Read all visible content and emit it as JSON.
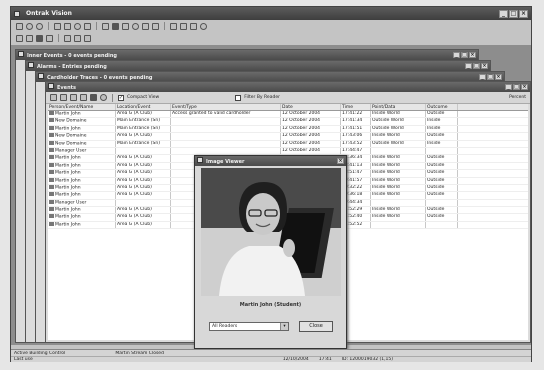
{
  "app": {
    "title": "Ontrak Vision"
  },
  "windows": [
    {
      "title": "Inner Events - 0 events pending"
    },
    {
      "title": "Alarms - Entries pending"
    },
    {
      "title": "Cardholder Traces - 0 events pending"
    }
  ],
  "events_window": {
    "title": "Events",
    "toolbar": {
      "compact_view_label": "Compact View",
      "filter_label": "Filter By Reader"
    },
    "columns": [
      "Person/Event/Name",
      "Location/Event",
      "Event/Type",
      "Date",
      "Time",
      "Point/Data",
      "Outcome"
    ],
    "extra_column": "Percent",
    "rows": [
      [
        "Martin John",
        "Area G (A Club)",
        "Access granted to valid cardholder",
        "12 October 2004",
        "17:41:22",
        "Inside World",
        "Outside"
      ],
      [
        "New Domaine",
        "Main Entrance (Sn)",
        "",
        "12 October 2004",
        "17:41:34",
        "Outside World",
        "Inside"
      ],
      [
        "Martin John",
        "Main Entrance (Sn)",
        "",
        "12 October 2004",
        "17:41:51",
        "Outside World",
        "Inside"
      ],
      [
        "New Domaine",
        "Area G (A Club)",
        "",
        "12 October 2004",
        "17:43:06",
        "Inside World",
        "Outside"
      ],
      [
        "New Domaine",
        "Main Entrance (Sn)",
        "",
        "12 October 2004",
        "17:43:52",
        "Outside World",
        "Inside"
      ],
      [
        "Manager User",
        "",
        "",
        "12 October 2004",
        "17:44:47",
        "",
        ""
      ],
      [
        "Martin John",
        "Area G (A Club)",
        "",
        "12 October 2004",
        "18:36:34",
        "Inside World",
        "Outside"
      ],
      [
        "Martin John",
        "Area G (A Club)",
        "",
        "12 October 2004",
        "18:41:13",
        "Inside World",
        "Outside"
      ],
      [
        "Martin John",
        "Area G (A Club)",
        "",
        "12 October 2004",
        "18:51:47",
        "Inside World",
        "Outside"
      ],
      [
        "Martin John",
        "Area G (A Club)",
        "",
        "12 October 2004",
        "19:41:57",
        "Inside World",
        "Outside"
      ],
      [
        "Martin John",
        "Area G (A Club)",
        "",
        "12 October 2004",
        "20:32:22",
        "Inside World",
        "Outside"
      ],
      [
        "Martin John",
        "Area G (A Club)",
        "",
        "12 October 2004",
        "20:36:18",
        "Inside World",
        "Outside"
      ],
      [
        "Manager User",
        "",
        "",
        "12 October 2004",
        "20:44:34",
        "",
        ""
      ],
      [
        "Martin John",
        "Area G (A Club)",
        "",
        "12 October 2004",
        "14:52:29",
        "Inside World",
        "Outside"
      ],
      [
        "Martin John",
        "Area G (A Club)",
        "",
        "12 October 2004",
        "14:52:40",
        "Inside World",
        "Outside"
      ],
      [
        "Martin John",
        "Area G (A Club)",
        "",
        "12 October 2004",
        "14:52:52",
        "",
        ""
      ]
    ]
  },
  "dialog": {
    "title": "Image Viewer",
    "caption": "Martin John (Student)",
    "select_value": "All Readers",
    "button_label": "Close"
  },
  "status": {
    "left_top": "Active Building Control",
    "center_top": "Martin Stream Closed",
    "left_bottom": "Last use",
    "mid1": "12/10/2004",
    "mid2": "17:41",
    "right": "ID: 1200019032 (1,15)"
  },
  "colors": {
    "titlebar": "#4a4a4a",
    "mdi_bg": "#8d8d8d"
  }
}
